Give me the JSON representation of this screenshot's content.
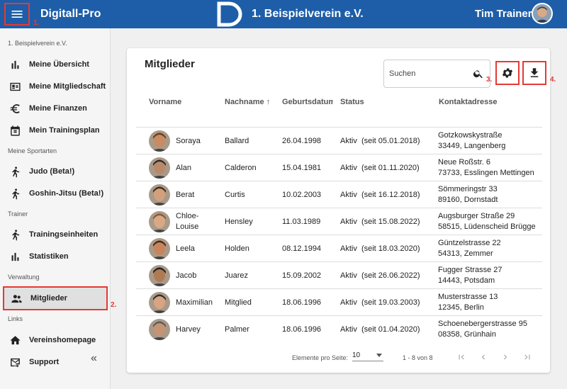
{
  "header": {
    "app_title": "Digitall-Pro",
    "club_name": "1. Beispielverein e.V.",
    "user_name": "Tim Trainer",
    "annotation": "1."
  },
  "sidebar": {
    "club_label": "1. Beispielverein e.V.",
    "items_main": [
      {
        "label": "Meine Übersicht",
        "icon": "bar-chart-icon"
      },
      {
        "label": "Meine Mitgliedschaft",
        "icon": "id-card-icon"
      },
      {
        "label": "Meine Finanzen",
        "icon": "euro-icon"
      },
      {
        "label": "Mein Trainingsplan",
        "icon": "calendar-icon"
      }
    ],
    "section_sports": "Meine Sportarten",
    "items_sports": [
      {
        "label": "Judo (Beta!)",
        "icon": "sport-icon"
      },
      {
        "label": "Goshin-Jitsu (Beta!)",
        "icon": "sport-icon"
      }
    ],
    "section_trainer": "Trainer",
    "items_trainer": [
      {
        "label": "Trainingseinheiten",
        "icon": "sport-icon"
      },
      {
        "label": "Statistiken",
        "icon": "bar-chart-icon"
      }
    ],
    "section_admin": "Verwaltung",
    "item_members": {
      "label": "Mitglieder",
      "icon": "people-icon",
      "annotation": "2."
    },
    "section_links": "Links",
    "items_links": [
      {
        "label": "Vereinshomepage",
        "icon": "home-icon"
      },
      {
        "label": "Support",
        "icon": "mail-icon"
      }
    ],
    "collapse_label": "«"
  },
  "members": {
    "title": "Mitglieder",
    "search_placeholder": "Suchen",
    "settings_annotation": "3.",
    "download_annotation": "4.",
    "columns": {
      "firstname": "Vorname",
      "lastname": "Nachname ↑",
      "birthdate": "Geburtsdatum",
      "status": "Status",
      "contact": "Kontaktadresse"
    },
    "rows": [
      {
        "first": "Soraya",
        "last": "Ballard",
        "birth": "26.04.1998",
        "status": "Aktiv  (seit 05.01.2018)",
        "street": "Gotzkowskystraße",
        "city": "33449, Langenberg",
        "skin": "#c98b63",
        "hair": "#6b3a1e"
      },
      {
        "first": "Alan",
        "last": "Calderon",
        "birth": "15.04.1981",
        "status": "Aktiv  (seit 01.11.2020)",
        "street": "Neue Roßstr. 6",
        "city": "73733, Esslingen Mettingen",
        "skin": "#b98a6a",
        "hair": "#2b2b2b"
      },
      {
        "first": "Berat",
        "last": "Curtis",
        "birth": "10.02.2003",
        "status": "Aktiv  (seit 16.12.2018)",
        "street": "Sömmeringstr 33",
        "city": "89160, Dornstadt",
        "skin": "#d3a07d",
        "hair": "#3a2a1e"
      },
      {
        "first": "Chloe-\nLouise",
        "last": "Hensley",
        "birth": "11.03.1989",
        "status": "Aktiv  (seit 15.08.2022)",
        "street": "Augsburger Straße 29",
        "city": "58515, Lüdenscheid Brügge",
        "skin": "#d9a985",
        "hair": "#8a5a32"
      },
      {
        "first": "Leela",
        "last": "Holden",
        "birth": "08.12.1994",
        "status": "Aktiv  (seit 18.03.2020)",
        "street": "Güntzelstrasse 22",
        "city": "54313, Zemmer",
        "skin": "#c8845c",
        "hair": "#4a2612"
      },
      {
        "first": "Jacob",
        "last": "Juarez",
        "birth": "15.09.2002",
        "status": "Aktiv  (seit 26.06.2022)",
        "street": "Fugger Strasse 27",
        "city": "14443, Potsdam",
        "skin": "#b07a55",
        "hair": "#1e1e1e"
      },
      {
        "first": "Maximilian",
        "last": "Mitglied",
        "birth": "18.06.1996",
        "status": "Aktiv  (seit 19.03.2003)",
        "street": "Musterstrasse 13",
        "city": "12345, Berlin",
        "skin": "#d8a482",
        "hair": "#2f2f2f"
      },
      {
        "first": "Harvey",
        "last": "Palmer",
        "birth": "18.06.1996",
        "status": "Aktiv  (seit 01.04.2020)",
        "street": "Schoenebergerstrasse 95",
        "city": "08358, Grünhain",
        "skin": "#c69474",
        "hair": "#5a5a5a"
      }
    ],
    "pagination": {
      "per_page_label": "Elemente pro Seite:",
      "per_page_value": "10",
      "range": "1 - 8 von 8"
    }
  },
  "colors": {
    "header_bg": "#1e5ea8",
    "annotation": "#e53935"
  }
}
